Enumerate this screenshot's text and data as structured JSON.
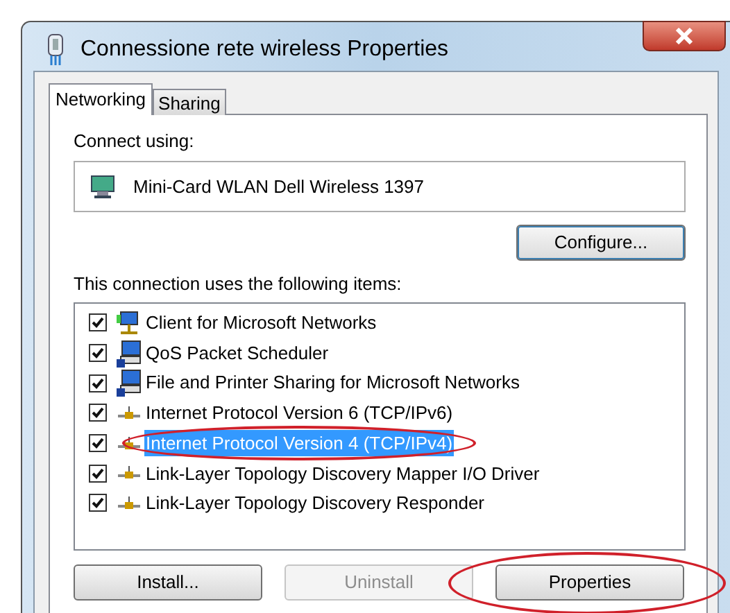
{
  "window": {
    "title": "Connessione rete wireless Properties"
  },
  "tabs": [
    {
      "label": "Networking",
      "selected": true
    },
    {
      "label": "Sharing",
      "selected": false
    }
  ],
  "connect_using": {
    "label": "Connect using:",
    "adapter": "Mini-Card WLAN Dell Wireless 1397",
    "button": "Configure..."
  },
  "items_label": "This connection uses the following items:",
  "items": [
    {
      "label": "Client for Microsoft Networks",
      "kind": "client",
      "checked": true,
      "selected": false,
      "circled": false
    },
    {
      "label": "QoS Packet Scheduler",
      "kind": "service",
      "checked": true,
      "selected": false,
      "circled": false
    },
    {
      "label": "File and Printer Sharing for Microsoft Networks",
      "kind": "service",
      "checked": true,
      "selected": false,
      "circled": false
    },
    {
      "label": "Internet Protocol Version 6 (TCP/IPv6)",
      "kind": "protocol",
      "checked": true,
      "selected": false,
      "circled": false
    },
    {
      "label": "Internet Protocol Version 4 (TCP/IPv4)",
      "kind": "protocol",
      "checked": true,
      "selected": true,
      "circled": true
    },
    {
      "label": "Link-Layer Topology Discovery Mapper I/O Driver",
      "kind": "protocol",
      "checked": true,
      "selected": false,
      "circled": false
    },
    {
      "label": "Link-Layer Topology Discovery Responder",
      "kind": "protocol",
      "checked": true,
      "selected": false,
      "circled": false
    }
  ],
  "buttons": [
    {
      "label": "Install...",
      "disabled": false,
      "circled": false
    },
    {
      "label": "Uninstall",
      "disabled": true,
      "circled": false
    },
    {
      "label": "Properties",
      "disabled": false,
      "circled": true
    }
  ]
}
